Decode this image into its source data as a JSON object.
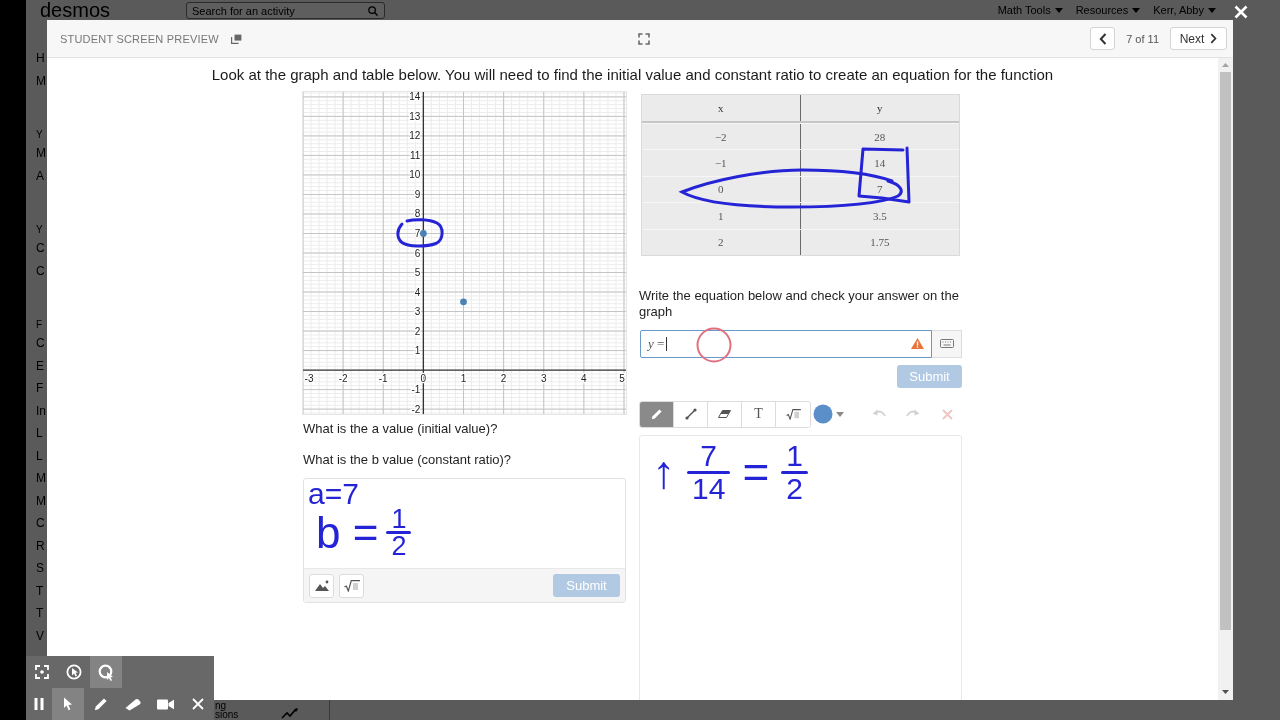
{
  "background_page": {
    "logo": "desmos",
    "search": {
      "placeholder": "Search for an activity"
    },
    "menus": [
      "Math Tools",
      "Resources",
      "Kerr, Abby"
    ],
    "sidebar_sections": [
      {
        "items": [
          "H",
          "M"
        ]
      },
      {
        "heading": "Y",
        "items": [
          "M",
          "A"
        ]
      },
      {
        "heading": "Y",
        "items": [
          "C",
          "C"
        ]
      },
      {
        "heading": "F",
        "items": [
          "C",
          "E",
          "F",
          "In",
          "L",
          "L",
          "M",
          "M",
          "C",
          "R",
          "S",
          "T",
          "T",
          "V"
        ]
      }
    ],
    "footer_texts": [
      "ng",
      "sions"
    ]
  },
  "preview": {
    "title": "STUDENT SCREEN PREVIEW",
    "page_counter": "7 of 11",
    "next_label": "Next",
    "prompt": "Look at the graph and table below. You will need to find the initial value and constant ratio to create an equation for the function",
    "graph": {
      "chart_data": {
        "type": "scatter",
        "x": [
          0,
          1
        ],
        "series": [
          {
            "color": "#4a82b4",
            "values": [
              7,
              3.5
            ]
          }
        ],
        "xlim": [
          -3,
          5.05
        ],
        "ylim": [
          -2.25,
          14.25
        ],
        "xticks": [
          -3,
          -2,
          -1,
          0,
          1,
          2,
          3,
          4,
          5
        ],
        "yticks": [
          -2,
          -1,
          1,
          2,
          3,
          4,
          5,
          6,
          7,
          8,
          9,
          10,
          11,
          12,
          13,
          14
        ],
        "grid": true
      }
    },
    "questions": [
      "What is the a value (initial value)?",
      "What is the b value (constant ratio)?"
    ],
    "sketch_response": {
      "ink_lines": [
        [
          {
            "kind": "text",
            "text": "a=7"
          }
        ],
        [
          {
            "kind": "text",
            "text": "b ="
          },
          {
            "kind": "fraction",
            "numerator": "1",
            "denominator": "2"
          }
        ]
      ],
      "tools": [
        {
          "kind": "image"
        },
        {
          "kind": "math"
        }
      ],
      "submit": {
        "label": "Submit",
        "disabled": true
      }
    },
    "table": {
      "columns": [
        "x",
        "y"
      ],
      "rows": [
        [
          "−2",
          "28"
        ],
        [
          "−1",
          "14"
        ],
        [
          "0",
          "7"
        ],
        [
          "1",
          "3.5"
        ],
        [
          "2",
          "1.75"
        ]
      ]
    },
    "equation_prompt": "Write the equation below and check your answer on the graph",
    "math_input": {
      "value": "*y* =",
      "focused": true,
      "warning": true
    },
    "equation_submit": {
      "label": "Submit",
      "disabled": true
    },
    "sketch_tools": [
      {
        "kind": "pencil",
        "selected": true
      },
      {
        "kind": "line",
        "selected": false
      },
      {
        "kind": "eraser",
        "selected": false
      },
      {
        "kind": "text",
        "label": "T",
        "selected": false
      },
      {
        "kind": "math",
        "selected": false
      }
    ],
    "color_picker": {
      "color": "#5b8fc9"
    },
    "sketch_actions": [
      {
        "kind": "undo",
        "disabled": true
      },
      {
        "kind": "redo",
        "disabled": true
      },
      {
        "kind": "clear",
        "disabled": true
      }
    ],
    "sketch_ink": [
      {
        "kind": "text",
        "text": "↑"
      },
      {
        "kind": "fraction",
        "numerator": "7",
        "denominator": "14"
      },
      {
        "kind": "text",
        "text": "="
      },
      {
        "kind": "fraction",
        "numerator": "1",
        "denominator": "2"
      }
    ]
  },
  "recorder_toolbar": {
    "rows": [
      [
        {
          "kind": "capture-region",
          "selected": false
        },
        {
          "kind": "click-effect",
          "selected": false
        },
        {
          "kind": "cursor-highlight",
          "selected": true
        }
      ],
      [
        {
          "kind": "pause",
          "selected": false
        },
        {
          "kind": "pointer",
          "selected": true
        },
        {
          "kind": "pen",
          "selected": false
        },
        {
          "kind": "highlighter",
          "selected": false
        },
        {
          "kind": "camera",
          "selected": false
        },
        {
          "kind": "close",
          "selected": false
        }
      ]
    ]
  }
}
